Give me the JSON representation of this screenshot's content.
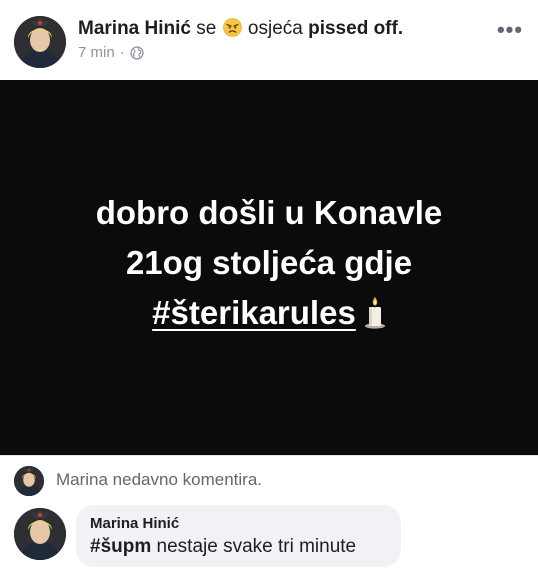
{
  "post": {
    "author": "Marina Hinić",
    "feeling_prefix": "se",
    "feeling_emoji": "angry-face-icon",
    "feeling_verb": "osjeća",
    "feeling_value": "pissed off.",
    "time": "7 min",
    "separator": "·",
    "privacy_icon": "globe-icon",
    "more_icon": "more-options-icon",
    "more_label": "•••",
    "status": {
      "line1": "dobro došli u Konavle",
      "line2": "21og stoljeća gdje",
      "hashtag": "#šterikarules",
      "emoji": "candle-icon",
      "background": "#0b0b0b",
      "text_color": "#ffffff"
    }
  },
  "recent_comment": {
    "notice": "Marina nedavno komentira."
  },
  "comment": {
    "author": "Marina Hinić",
    "hashtag": "#šupm",
    "text": "nestaje svake tri minute"
  },
  "colors": {
    "meta_gray": "#8d949e",
    "bubble_bg": "#f0f2f5",
    "divider": "#e4e6eb"
  }
}
